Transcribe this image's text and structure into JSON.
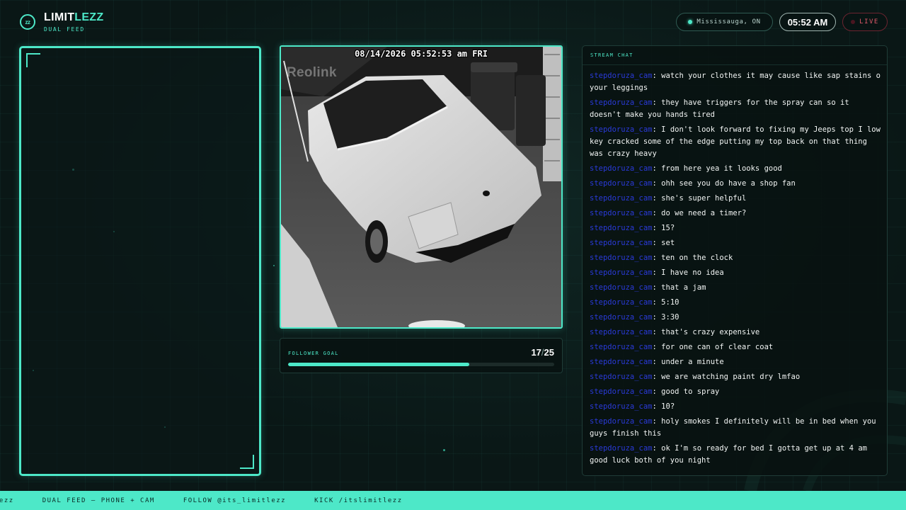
{
  "brand": {
    "logo": "zz",
    "title_main": "LIMIT",
    "title_accent": "LEZZ",
    "subtitle": "DUAL FEED"
  },
  "header": {
    "location": "Mississauga, ON",
    "time": "05:52 AM",
    "live_label": "LIVE"
  },
  "camera": {
    "timestamp": "08/14/2026 05:52:53 am FRI",
    "watermark": "Reolink"
  },
  "follower_goal": {
    "label": "FOLLOWER GOAL",
    "current": "17",
    "separator": "/",
    "target": "25",
    "progress_fraction": 0.68
  },
  "chat": {
    "title": "STREAM CHAT",
    "messages": [
      {
        "user": "stepdoruza_cam",
        "text": "watch your clothes it may cause like sap stains o your leggings"
      },
      {
        "user": "stepdoruza_cam",
        "text": "they have triggers for the spray can so it doesn't make you hands tired"
      },
      {
        "user": "stepdoruza_cam",
        "text": "I don't look forward to fixing my Jeeps top I low key cracked some of the edge putting my top back on that thing was crazy heavy"
      },
      {
        "user": "stepdoruza_cam",
        "text": "from here yea it looks good"
      },
      {
        "user": "stepdoruza_cam",
        "text": "ohh see you do have a shop fan"
      },
      {
        "user": "stepdoruza_cam",
        "text": "she's super helpful"
      },
      {
        "user": "stepdoruza_cam",
        "text": "do we need a timer?"
      },
      {
        "user": "stepdoruza_cam",
        "text": "15?"
      },
      {
        "user": "stepdoruza_cam",
        "text": "set"
      },
      {
        "user": "stepdoruza_cam",
        "text": "ten on the clock"
      },
      {
        "user": "stepdoruza_cam",
        "text": "I have no idea"
      },
      {
        "user": "stepdoruza_cam",
        "text": "that a jam"
      },
      {
        "user": "stepdoruza_cam",
        "text": "5:10"
      },
      {
        "user": "stepdoruza_cam",
        "text": "3:30"
      },
      {
        "user": "stepdoruza_cam",
        "text": "that's crazy expensive"
      },
      {
        "user": "stepdoruza_cam",
        "text": "for one can of clear coat"
      },
      {
        "user": "stepdoruza_cam",
        "text": "under a minute"
      },
      {
        "user": "stepdoruza_cam",
        "text": "we are watching paint dry lmfao"
      },
      {
        "user": "stepdoruza_cam",
        "text": "good to spray"
      },
      {
        "user": "stepdoruza_cam",
        "text": "10?"
      },
      {
        "user": "stepdoruza_cam",
        "text": "holy smokes I definitely will be in bed when you guys finish this"
      },
      {
        "user": "stepdoruza_cam",
        "text": "ok I'm so ready for bed I gotta get up at 4 am good luck both of you night"
      }
    ]
  },
  "ticker": {
    "items": [
      "lezz",
      "DUAL FEED — PHONE + CAM",
      "FOLLOW @its_limitlezz",
      "KICK /itslimitlezz"
    ]
  },
  "colors": {
    "accent": "#4de8c8",
    "background": "#0a1716",
    "chat_username": "#2a3ad8",
    "live": "#e05a6a"
  }
}
